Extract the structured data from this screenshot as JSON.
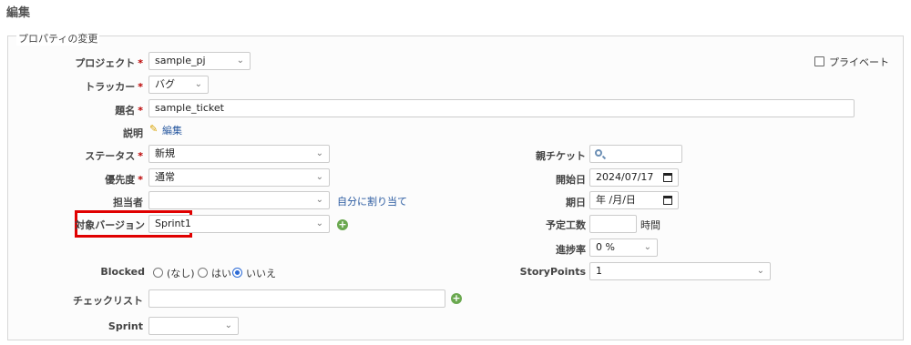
{
  "page": {
    "title": "編集"
  },
  "fieldset": {
    "legend": "プロパティの変更"
  },
  "required_mark": "*",
  "project": {
    "label": "プロジェクト",
    "value": "sample_pj"
  },
  "private": {
    "label": "プライベート",
    "checked": false
  },
  "tracker": {
    "label": "トラッカー",
    "value": "バグ"
  },
  "subject": {
    "label": "題名",
    "value": "sample_ticket"
  },
  "description": {
    "label": "説明",
    "edit_link": "編集"
  },
  "status": {
    "label": "ステータス",
    "value": "新規"
  },
  "priority": {
    "label": "優先度",
    "value": "通常"
  },
  "assignee": {
    "label": "担当者",
    "value": "",
    "assign_to_me": "自分に割り当て"
  },
  "target_version": {
    "label": "対象バージョン",
    "value": "Sprint1"
  },
  "parent_ticket": {
    "label": "親チケット",
    "value": ""
  },
  "start_date": {
    "label": "開始日",
    "value": "2024/07/17"
  },
  "due_date": {
    "label": "期日",
    "value": "年 /月/日"
  },
  "estimated_time": {
    "label": "予定工数",
    "value": "",
    "unit": "時間"
  },
  "done_ratio": {
    "label": "進捗率",
    "value": "0 %"
  },
  "blocked": {
    "label": "Blocked",
    "options": [
      "(なし)",
      "はい",
      "いいえ"
    ],
    "selected": "いいえ"
  },
  "story_points": {
    "label": "StoryPoints",
    "value": "1"
  },
  "checklist": {
    "label": "チェックリスト",
    "value": ""
  },
  "sprint": {
    "label": "Sprint",
    "value": ""
  },
  "colors": {
    "highlight": "#e00000",
    "required": "#bb0000",
    "link": "#2a5aa0",
    "add": "#6aa84f"
  }
}
